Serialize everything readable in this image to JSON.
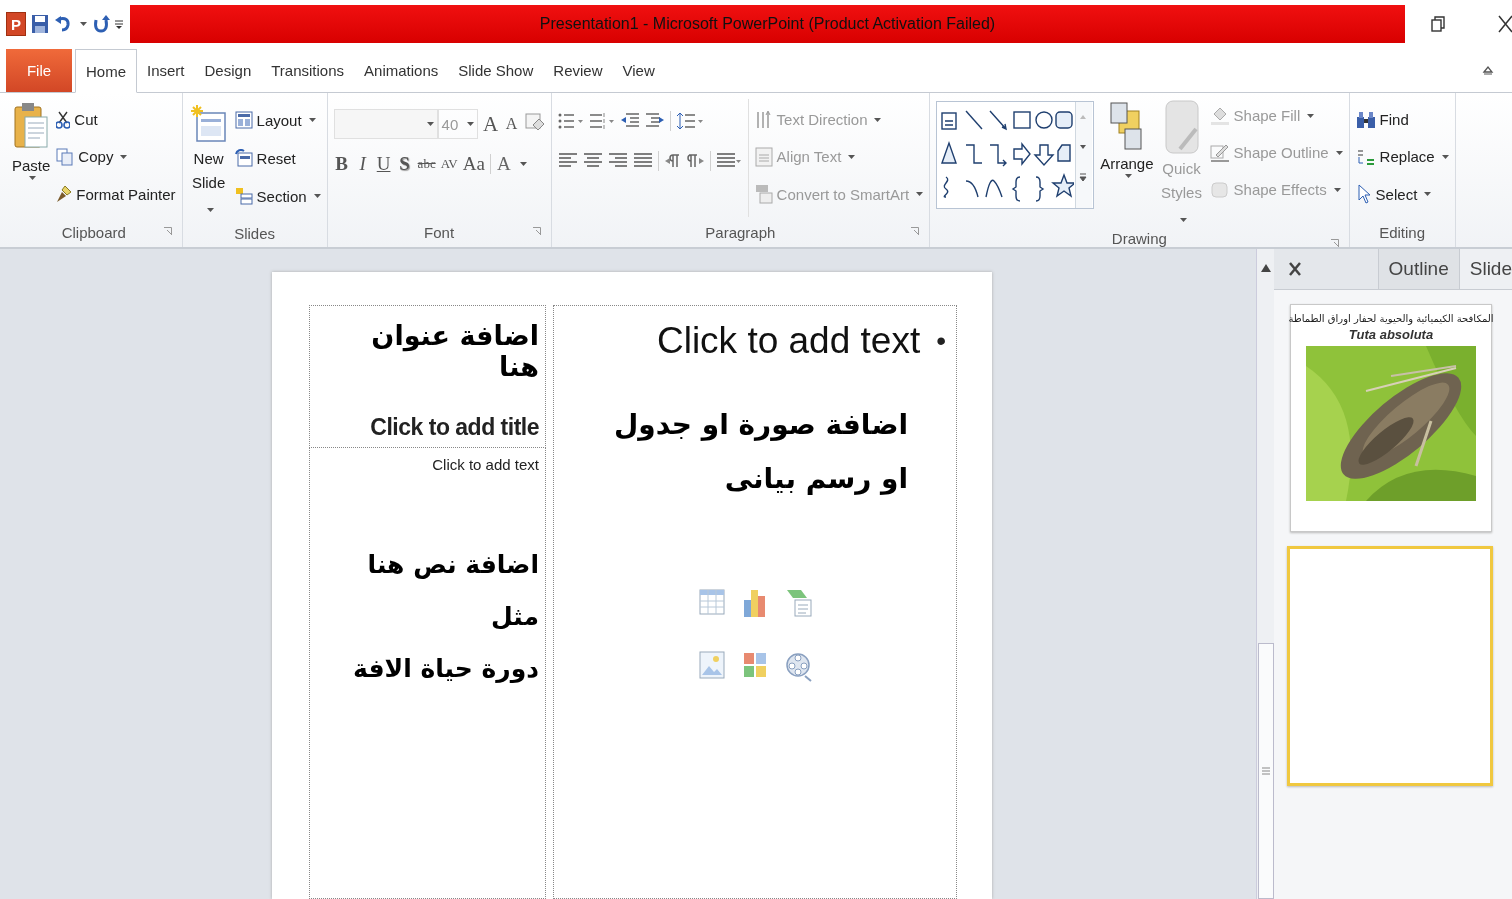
{
  "title_bar": {
    "logo": "P",
    "title": "Presentation1  -  Microsoft PowerPoint (Product Activation Failed)"
  },
  "tabs": [
    {
      "label": "File",
      "kind": "file",
      "selected": false
    },
    {
      "label": "Home",
      "kind": "tab",
      "selected": true
    },
    {
      "label": "Insert",
      "kind": "tab",
      "selected": false
    },
    {
      "label": "Design",
      "kind": "tab",
      "selected": false
    },
    {
      "label": "Transitions",
      "kind": "tab",
      "selected": false
    },
    {
      "label": "Animations",
      "kind": "tab",
      "selected": false
    },
    {
      "label": "Slide Show",
      "kind": "tab",
      "selected": false
    },
    {
      "label": "Review",
      "kind": "tab",
      "selected": false
    },
    {
      "label": "View",
      "kind": "tab",
      "selected": false
    }
  ],
  "ribbon": {
    "clipboard": {
      "label": "Clipboard",
      "paste": "Paste",
      "cut": "Cut",
      "copy": "Copy",
      "format_painter": "Format Painter"
    },
    "slides": {
      "label": "Slides",
      "new_slide": "New Slide",
      "layout": "Layout",
      "reset": "Reset",
      "section": "Section"
    },
    "font": {
      "label": "Font",
      "font_size": {
        "value": "40",
        "disabled": true
      },
      "size_buttons": [
        "A",
        "A"
      ],
      "format_buttons": [
        "B",
        "I",
        "U",
        "S",
        "abc",
        "AV",
        "Aa"
      ],
      "font_color": "A"
    },
    "paragraph": {
      "label": "Paragraph",
      "text_direction": {
        "label": "Text Direction",
        "disabled": true
      },
      "align_text": {
        "label": "Align Text",
        "disabled": true
      },
      "convert_smartart": {
        "label": "Convert to SmartArt",
        "disabled": true
      }
    },
    "drawing": {
      "label": "Drawing",
      "arrange": "Arrange",
      "quick_styles": {
        "label": "Quick Styles",
        "disabled": true
      },
      "shape_fill": {
        "label": "Shape Fill",
        "disabled": true
      },
      "shape_outline": {
        "label": "Shape Outline",
        "disabled": true
      },
      "shape_effects": {
        "label": "Shape Effects",
        "disabled": true
      }
    },
    "editing": {
      "label": "Editing",
      "find": "Find",
      "replace": "Replace",
      "select": "Select"
    }
  },
  "slide": {
    "title_box": {
      "arabic": "اضافة عنوان هنا",
      "placeholder": "Click to add title"
    },
    "text_box": {
      "placeholder": "Click to add text",
      "arabic": "اضافة نص هنا مثل\nدورة حياة الافة"
    },
    "content_box": {
      "bullet": "•",
      "placeholder": "Click to add text",
      "arabic": "اضافة صورة او جدول\nاو رسم بيانى"
    }
  },
  "side_pane": {
    "tabs": [
      {
        "label": "Outline",
        "selected": false
      },
      {
        "label": "Slide",
        "selected": true
      }
    ],
    "thumbnails": [
      {
        "kind": "picture",
        "title": "المكافحة الكيميائية والحيوية لحفار اوراق الطماطة",
        "subtitle": "Tuta absoluta",
        "selected": false
      },
      {
        "kind": "blank",
        "selected": true
      }
    ]
  }
}
